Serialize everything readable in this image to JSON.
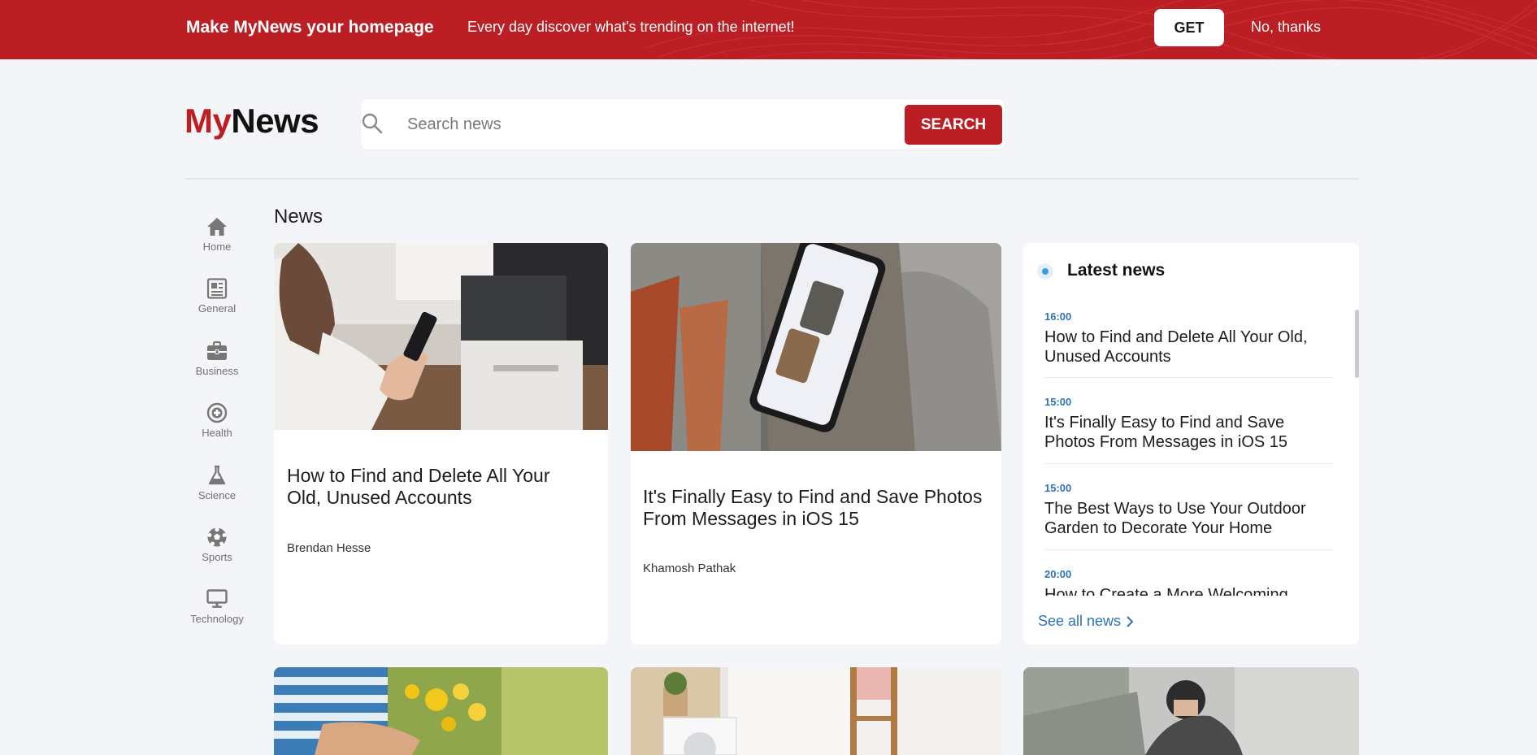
{
  "banner": {
    "title": "Make MyNews your homepage",
    "subtitle": "Every day discover what's trending on the internet!",
    "get_label": "GET",
    "dismiss_label": "No, thanks",
    "color": "#bb1e23"
  },
  "header": {
    "logo_my": "My",
    "logo_news": "News",
    "search_placeholder": "Search news",
    "search_button": "SEARCH"
  },
  "sidebar": {
    "items": [
      {
        "label": "Home",
        "icon": "home-icon"
      },
      {
        "label": "General",
        "icon": "newspaper-icon"
      },
      {
        "label": "Business",
        "icon": "briefcase-icon"
      },
      {
        "label": "Health",
        "icon": "health-icon"
      },
      {
        "label": "Science",
        "icon": "flask-icon"
      },
      {
        "label": "Sports",
        "icon": "soccer-ball-icon"
      },
      {
        "label": "Technology",
        "icon": "monitor-icon"
      }
    ]
  },
  "main": {
    "section_title": "News",
    "articles": [
      {
        "title": "How to Find and Delete All Your Old, Unused Accounts",
        "author": "Brendan Hesse"
      },
      {
        "title": "It's Finally Easy to Find and Save Photos From Messages in iOS 15",
        "author": "Khamosh Pathak"
      }
    ]
  },
  "latest": {
    "title": "Latest news",
    "items": [
      {
        "time": "16:00",
        "title": "How to Find and Delete All Your Old, Unused Accounts"
      },
      {
        "time": "15:00",
        "title": "It's Finally Easy to Find and Save Photos From Messages in iOS 15"
      },
      {
        "time": "15:00",
        "title": "The Best Ways to Use Your Outdoor Garden to Decorate Your Home"
      },
      {
        "time": "20:00",
        "title": "How to Create a More Welcoming"
      }
    ],
    "see_all": "See all news"
  }
}
